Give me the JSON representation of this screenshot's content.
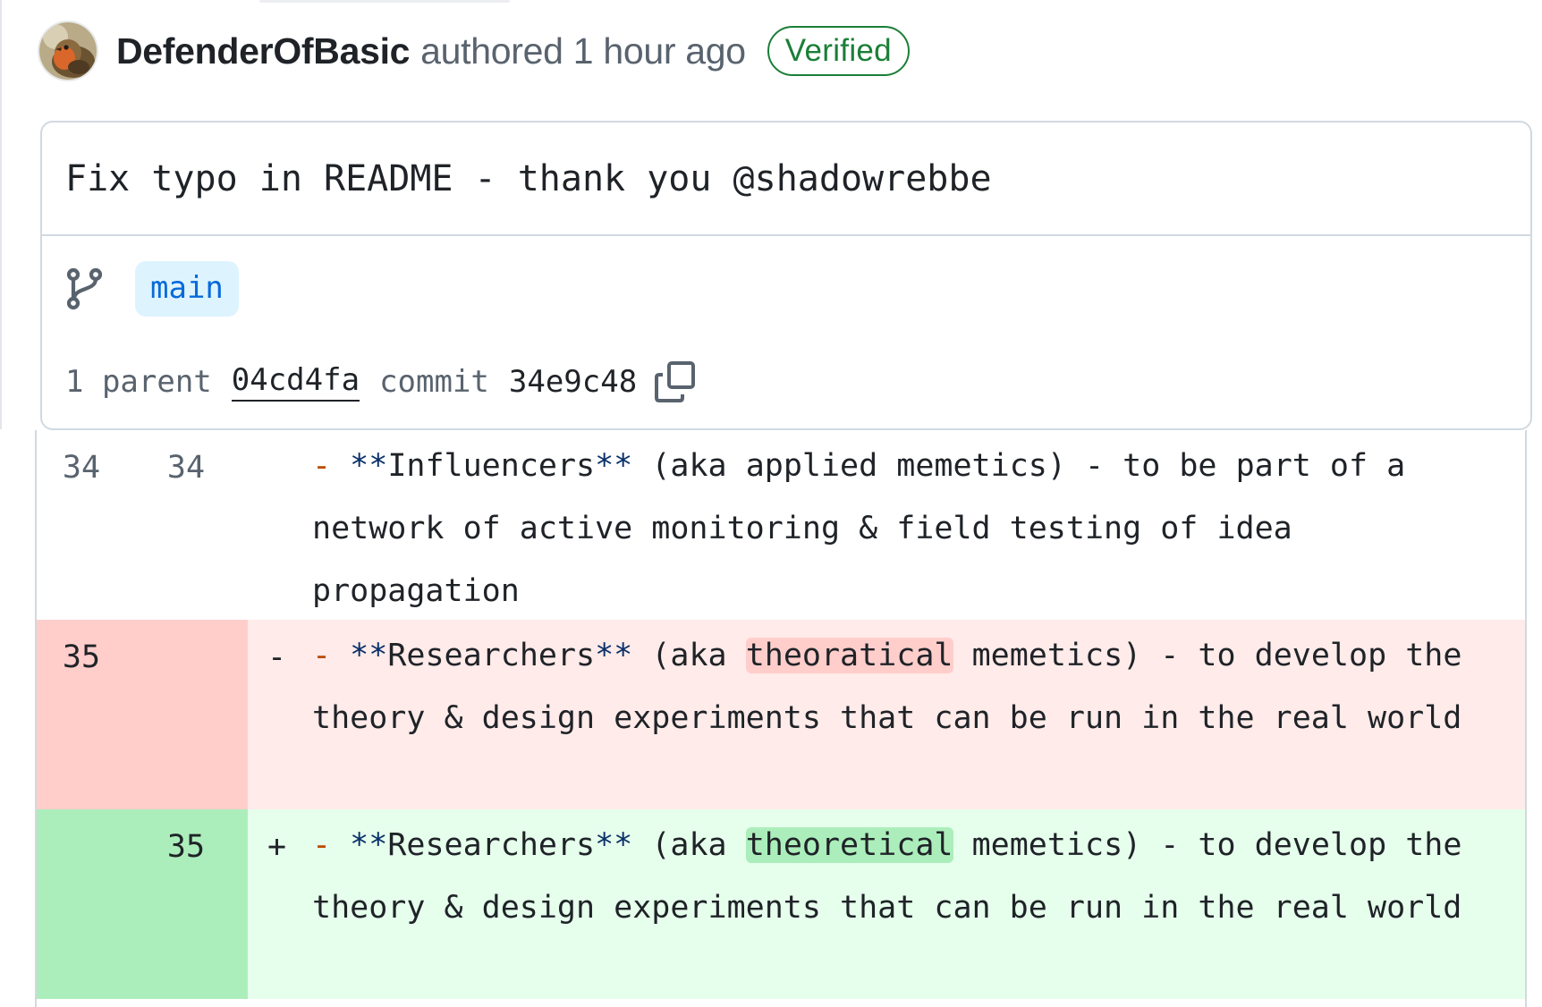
{
  "author": {
    "name": "DefenderOfBasic",
    "authored_text": "authored 1 hour ago",
    "verified_label": "Verified",
    "avatar_icon": "robin-bird-avatar"
  },
  "commit": {
    "message": "Fix typo in README - thank you @shadowrebbe",
    "branch": "main",
    "branch_icon": "git-branch-icon",
    "parent_label": "1 parent",
    "parent_sha": "04cd4fa",
    "commit_label": "commit",
    "commit_sha": "34e9c48",
    "copy_icon": "copy-icon"
  },
  "diff": {
    "rows": [
      {
        "type": "context",
        "old_line": "34",
        "new_line": "34",
        "marker": "",
        "bullet": "-",
        "emph_open": "**",
        "bold_word": "Influencers",
        "emph_close": "**",
        "pre": " (aka applied memetics) - to be part of a network of active monitoring & field testing of idea propagation",
        "highlight": "",
        "post": ""
      },
      {
        "type": "deletion",
        "old_line": "35",
        "new_line": "",
        "marker": "-",
        "bullet": "-",
        "emph_open": "**",
        "bold_word": "Researchers",
        "emph_close": "**",
        "pre": " (aka ",
        "highlight": "theoratical",
        "post": " memetics) - to develop the theory & design experiments that can be run in the real world"
      },
      {
        "type": "addition",
        "old_line": "",
        "new_line": "35",
        "marker": "+",
        "bullet": "-",
        "emph_open": "**",
        "bold_word": "Researchers",
        "emph_close": "**",
        "pre": " (aka ",
        "highlight": "theoretical",
        "post": " memetics) - to develop the theory & design experiments that can be run in the real world"
      }
    ]
  },
  "colors": {
    "verified_green": "#1a7f37",
    "branch_blue": "#0969da",
    "deletion_bg": "#ffebe9",
    "deletion_gutter": "#ffcecb",
    "addition_bg": "#e6ffec",
    "addition_gutter": "#aceebb",
    "bullet_orange": "#bc4c00"
  }
}
